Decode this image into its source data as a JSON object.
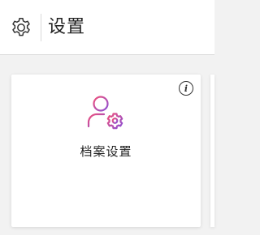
{
  "header": {
    "title": "设置",
    "icon": "gear-icon"
  },
  "card": {
    "label": "档案设置",
    "icon": "user-settings-icon",
    "info_symbol": "i",
    "gradient_start": "#f0507a",
    "gradient_end": "#8b4fd6"
  }
}
